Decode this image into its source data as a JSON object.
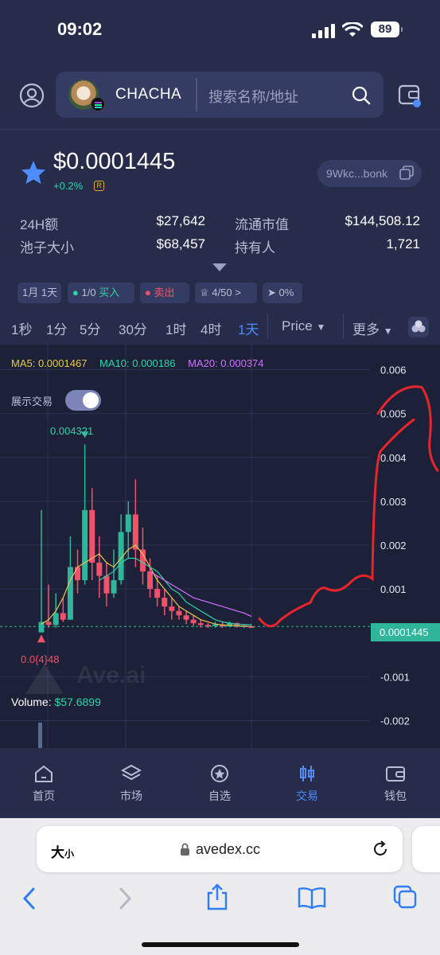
{
  "status_bar": {
    "time": "09:02",
    "battery": "89"
  },
  "header": {
    "token_name": "CHACHA",
    "search_placeholder": "搜索名称/地址"
  },
  "price": {
    "value": "$0.0001445",
    "change": "+0.2%",
    "address": "9Wkc...bonk"
  },
  "stats": {
    "vol_label": "24H额",
    "vol_value": "$27,642",
    "pool_label": "池子大小",
    "pool_value": "$68,457",
    "mcap_label": "流通市值",
    "mcap_value": "$144,508.12",
    "holders_label": "持有人",
    "holders_value": "1,721"
  },
  "tags": {
    "age": "1月 1天",
    "buys_prefix": "1/0",
    "buys_label": "买入",
    "sells_label": "卖出",
    "rank": "4/50",
    "rank_arrow": ">",
    "runner": "0%"
  },
  "timeframes": [
    "1秒",
    "1分",
    "5分",
    "30分",
    "1时",
    "4时",
    "1天"
  ],
  "timeframe_active": "1天",
  "price_mode": "Price",
  "more_label": "更多",
  "chart_overlay": {
    "ma5_label": "MA5: ",
    "ma5_value": "0.0001467",
    "ma10_label": "MA10: ",
    "ma10_value": "0.000186",
    "ma20_label": "MA20: ",
    "ma20_value": "0.000374",
    "toggle_label": "展示交易",
    "high_label": "0.004321",
    "low_label": "0.0{4}48",
    "volume_label": "Volume: ",
    "volume_value": "$57.6899",
    "current_price_tag": "0.0001445",
    "watermark": "Ave.ai"
  },
  "chart_data": {
    "type": "candlestick",
    "y_ticks": [
      "0.006",
      "0.005",
      "0.004",
      "0.003",
      "0.002",
      "0.001",
      "-0.001",
      "-0.002"
    ],
    "ylim": [
      -0.0025,
      0.0063
    ],
    "current_price": 0.0001445,
    "candles": [
      {
        "o": 1e-05,
        "c": 0.00025,
        "h": 0.0028,
        "l": 1e-05
      },
      {
        "o": 0.00025,
        "c": 0.00018,
        "h": 0.0011,
        "l": 0.00012
      },
      {
        "o": 0.00018,
        "c": 0.00045,
        "h": 0.0009,
        "l": 0.00012
      },
      {
        "o": 0.00045,
        "c": 0.0003,
        "h": 0.0008,
        "l": 0.00025
      },
      {
        "o": 0.0003,
        "c": 0.0015,
        "h": 0.0022,
        "l": 0.0003
      },
      {
        "o": 0.0015,
        "c": 0.0012,
        "h": 0.0019,
        "l": 0.0009
      },
      {
        "o": 0.0012,
        "c": 0.0028,
        "h": 0.0043,
        "l": 0.0011
      },
      {
        "o": 0.0028,
        "c": 0.0016,
        "h": 0.0033,
        "l": 0.0012
      },
      {
        "o": 0.0016,
        "c": 0.0013,
        "h": 0.0022,
        "l": 0.0008
      },
      {
        "o": 0.0013,
        "c": 0.0009,
        "h": 0.0016,
        "l": 0.0006
      },
      {
        "o": 0.0009,
        "c": 0.0012,
        "h": 0.0019,
        "l": 0.0008
      },
      {
        "o": 0.0012,
        "c": 0.0023,
        "h": 0.0027,
        "l": 0.0011
      },
      {
        "o": 0.0023,
        "c": 0.0027,
        "h": 0.003,
        "l": 0.0017
      },
      {
        "o": 0.0027,
        "c": 0.0019,
        "h": 0.0035,
        "l": 0.0015
      },
      {
        "o": 0.0019,
        "c": 0.0014,
        "h": 0.0024,
        "l": 0.0011
      },
      {
        "o": 0.0014,
        "c": 0.001,
        "h": 0.0017,
        "l": 0.0008
      },
      {
        "o": 0.001,
        "c": 0.0008,
        "h": 0.0013,
        "l": 0.0006
      },
      {
        "o": 0.0008,
        "c": 0.0006,
        "h": 0.001,
        "l": 0.0004
      },
      {
        "o": 0.0006,
        "c": 0.0005,
        "h": 0.0008,
        "l": 0.0003
      },
      {
        "o": 0.0005,
        "c": 0.0004,
        "h": 0.0006,
        "l": 0.0003
      },
      {
        "o": 0.0004,
        "c": 0.0003,
        "h": 0.0005,
        "l": 0.0002
      },
      {
        "o": 0.0003,
        "c": 0.00022,
        "h": 0.0004,
        "l": 0.00015
      },
      {
        "o": 0.00022,
        "c": 0.00018,
        "h": 0.0003,
        "l": 0.00012
      },
      {
        "o": 0.00018,
        "c": 0.00016,
        "h": 0.00022,
        "l": 0.00011
      },
      {
        "o": 0.00016,
        "c": 0.00019,
        "h": 0.00025,
        "l": 0.00012
      },
      {
        "o": 0.00019,
        "c": 0.00015,
        "h": 0.00024,
        "l": 0.00011
      },
      {
        "o": 0.00015,
        "c": 0.00022,
        "h": 0.00026,
        "l": 0.00013
      },
      {
        "o": 0.00022,
        "c": 0.00017,
        "h": 0.00024,
        "l": 0.00012
      },
      {
        "o": 0.00017,
        "c": 0.00015,
        "h": 0.00019,
        "l": 0.00011
      },
      {
        "o": 0.00015,
        "c": 0.000145,
        "h": 0.00017,
        "l": 0.00012
      }
    ],
    "ma5": [
      0.0002,
      0.0003,
      0.0005,
      0.0008,
      0.0012,
      0.0015,
      0.0016,
      0.0017,
      0.0018,
      0.0016,
      0.0015,
      0.0017,
      0.0019,
      0.002,
      0.0018,
      0.0015,
      0.0012,
      0.001,
      0.0008,
      0.0006,
      0.0005,
      0.0004,
      0.0003,
      0.00025,
      0.0002,
      0.00018,
      0.00017,
      0.00016,
      0.00015,
      0.0001467
    ],
    "ma10": [
      null,
      null,
      null,
      null,
      null,
      null,
      null,
      null,
      0.0012,
      0.0013,
      0.0014,
      0.0016,
      0.0017,
      0.0017,
      0.0016,
      0.0015,
      0.0014,
      0.0012,
      0.001,
      0.0009,
      0.0007,
      0.0006,
      0.0005,
      0.0004,
      0.0003,
      0.00025,
      0.00022,
      0.0002,
      0.00019,
      0.000186
    ],
    "ma20": [
      null,
      null,
      null,
      null,
      null,
      null,
      null,
      null,
      null,
      null,
      null,
      null,
      null,
      null,
      null,
      0.0014,
      0.0013,
      0.0012,
      0.0011,
      0.001,
      0.0009,
      0.0008,
      0.00075,
      0.0007,
      0.00065,
      0.0006,
      0.00055,
      0.0005,
      0.00045,
      0.000374
    ]
  },
  "bottom_nav": [
    {
      "label": "首页",
      "icon": "home-icon"
    },
    {
      "label": "市场",
      "icon": "layers-icon"
    },
    {
      "label": "自选",
      "icon": "star-circle-icon"
    },
    {
      "label": "交易",
      "icon": "candlestick-icon"
    },
    {
      "label": "钱包",
      "icon": "wallet-icon"
    }
  ],
  "browser": {
    "text_size": "大",
    "text_size_small": "小",
    "url": "avedex.cc"
  },
  "colors": {
    "bg": "#262c4a",
    "chart_bg": "#1c2138",
    "up": "#2eb59a",
    "down": "#f0526c",
    "accent": "#4f8dff",
    "annotation": "#e8242c"
  }
}
